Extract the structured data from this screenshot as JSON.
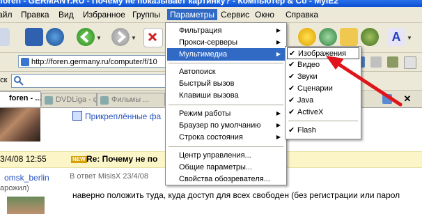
{
  "window": {
    "title": "foren - GERMANY.RU - Почему не показывает картинку? - Компьютер & Co - MyIE2"
  },
  "menubar": {
    "items": [
      {
        "label": "Файл"
      },
      {
        "label": "Правка"
      },
      {
        "label": "Вид"
      },
      {
        "label": "Избранное"
      },
      {
        "label": "Группы"
      },
      {
        "label": "Параметры"
      },
      {
        "label": "Сервис"
      },
      {
        "label": "Окно"
      },
      {
        "label": "Справка"
      }
    ]
  },
  "address": {
    "label": "",
    "url": "http://foren.germany.ru/computer/f/10"
  },
  "search": {
    "label": "иск",
    "value": ""
  },
  "tabs": [
    {
      "label": "foren - ..."
    },
    {
      "label": "DVDLiga - фи..."
    },
    {
      "label": "Фильмы ..."
    }
  ],
  "page": {
    "pinned_label": "Прикреплённые фа",
    "post_date": "3/4/08 12:55",
    "new_badge": "NEW",
    "post_title": "Re: Почему не по",
    "author_name": "omsk_berlin",
    "author_status": "арожил)",
    "reply_to": "В ответ MisisX 23/4/08",
    "post_text": "наверно положить туда, куда доступ для всех свободен (без регистрации или парол"
  },
  "params_menu": {
    "items": [
      {
        "label": "Фильтрация",
        "submenu": true
      },
      {
        "label": "Прокси-серверы",
        "submenu": true
      },
      {
        "label": "Мультимедиа",
        "submenu": true,
        "highlighted": true
      },
      {
        "label": "Автопоиск"
      },
      {
        "label": "Быстрый вызов"
      },
      {
        "label": "Клавиши вызова"
      },
      {
        "label": "Режим работы",
        "submenu": true
      },
      {
        "label": "Браузер по умолчанию",
        "submenu": true
      },
      {
        "label": "Строка состояния",
        "submenu": true
      },
      {
        "label": "Центр управления..."
      },
      {
        "label": "Общие параметры..."
      },
      {
        "label": "Свойства обозревателя..."
      }
    ]
  },
  "multimedia_submenu": {
    "items": [
      {
        "label": "Изображения",
        "checked": true
      },
      {
        "label": "Видео",
        "checked": true
      },
      {
        "label": "Звуки",
        "checked": true
      },
      {
        "label": "Сценарии",
        "checked": true
      },
      {
        "label": "Java",
        "checked": true
      },
      {
        "label": "ActiveX",
        "checked": true
      },
      {
        "label": "Flash",
        "checked": true
      }
    ],
    "check_glyph": "✔"
  },
  "colors": {
    "highlight": "#316ac5",
    "annotation_arrow": "#e0141a"
  },
  "icons": [
    "back-icon",
    "forward-icon",
    "stop-icon",
    "save-icon",
    "ie-globe-icon",
    "favorites-star-icon",
    "refresh-icon",
    "folder-icon",
    "user-icon",
    "translate-icon",
    "close-icon"
  ]
}
